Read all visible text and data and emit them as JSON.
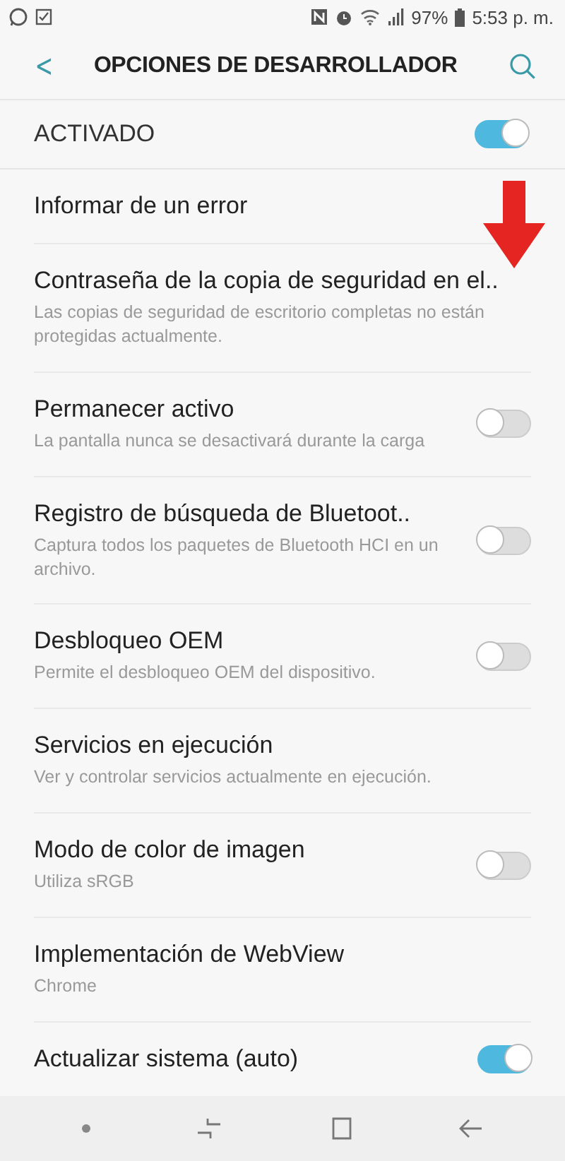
{
  "status_bar": {
    "battery": "97%",
    "time": "5:53 p. m."
  },
  "header": {
    "back": "<",
    "title": "OPCIONES DE DESARROLLADOR"
  },
  "master": {
    "label": "ACTIVADO",
    "on": true
  },
  "settings": [
    {
      "kind": "plain",
      "title": "Informar de un error"
    },
    {
      "kind": "plain",
      "title": "Contraseña de la copia de seguridad en el..",
      "subtitle": "Las copias de seguridad de escritorio completas no están protegidas actualmente."
    },
    {
      "kind": "toggle",
      "title": "Permanecer activo",
      "subtitle": "La pantalla nunca se desactivará durante la carga",
      "on": false
    },
    {
      "kind": "toggle",
      "title": "Registro de búsqueda de Bluetoot..",
      "subtitle": "Captura todos los paquetes de Bluetooth HCI en un archivo.",
      "on": false
    },
    {
      "kind": "toggle",
      "title": "Desbloqueo OEM",
      "subtitle": "Permite el desbloqueo OEM del dispositivo.",
      "on": false
    },
    {
      "kind": "plain",
      "title": "Servicios en ejecución",
      "subtitle": "Ver y controlar servicios actualmente en ejecución."
    },
    {
      "kind": "toggle",
      "title": "Modo de color de imagen",
      "subtitle": "Utiliza sRGB",
      "on": false
    },
    {
      "kind": "plain",
      "title": "Implementación de WebView",
      "subtitle": "Chrome"
    },
    {
      "kind": "toggle",
      "title": "Actualizar sistema (auto)",
      "on": true
    }
  ]
}
